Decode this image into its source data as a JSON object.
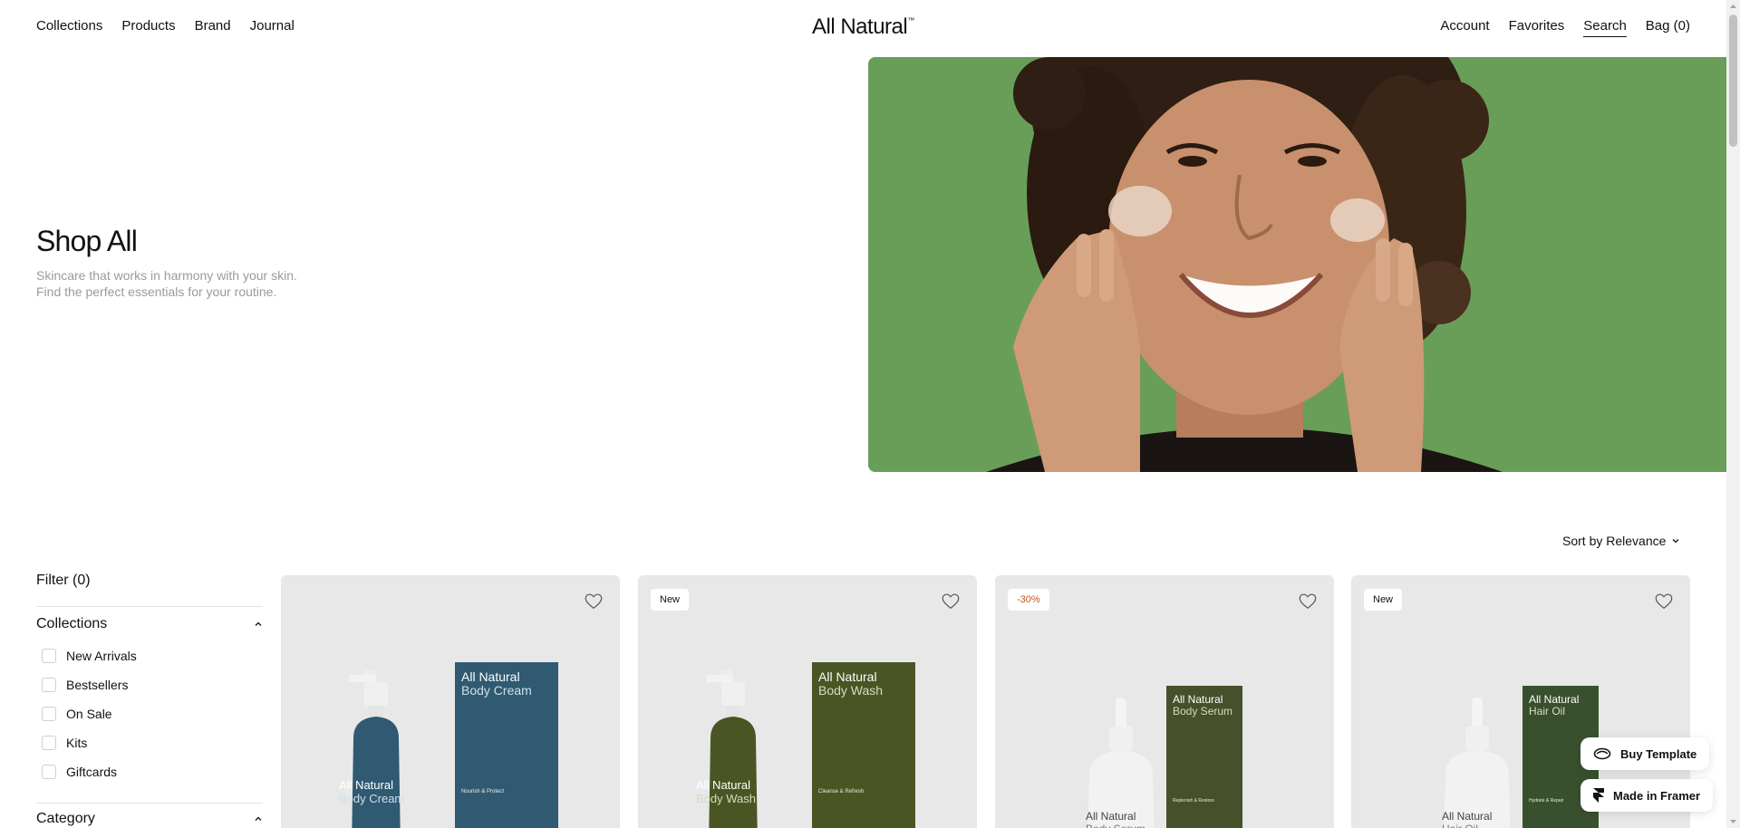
{
  "header": {
    "logo": "All Natural",
    "logo_tm": "™",
    "nav_left": [
      "Collections",
      "Products",
      "Brand",
      "Journal"
    ],
    "nav_right": {
      "account": "Account",
      "favorites": "Favorites",
      "search": "Search",
      "bag": "Bag (0)"
    }
  },
  "hero": {
    "title": "Shop All",
    "subtitle_line1": "Skincare that works in harmony with your skin.",
    "subtitle_line2": "Find the perfect essentials for your routine.",
    "image_bg": "#6fa35f"
  },
  "sort": {
    "label": "Sort by Relevance"
  },
  "filters": {
    "title": "Filter (0)",
    "collections": {
      "label": "Collections",
      "items": [
        "New Arrivals",
        "Bestsellers",
        "On Sale",
        "Kits",
        "Giftcards"
      ]
    },
    "category": {
      "label": "Category"
    }
  },
  "products": [
    {
      "badge": "",
      "brand": "All Natural",
      "name": "Body Cream",
      "tagline": "Nourish & Protect",
      "color": "#2f5a72"
    },
    {
      "badge": "New",
      "brand": "All Natural",
      "name": "Body Wash",
      "tagline": "Cleanse & Refresh",
      "color": "#4a5524"
    },
    {
      "badge": "-30%",
      "brand": "All Natural",
      "name": "Body Serum",
      "tagline": "Replenish & Restore",
      "color": "#46502a"
    },
    {
      "badge": "New",
      "brand": "All Natural",
      "name": "Hair Oil",
      "tagline": "Hydrate & Repair",
      "color": "#39502f"
    }
  ],
  "framer": {
    "buy_template": "Buy Template",
    "made_in_framer": "Made in Framer"
  }
}
